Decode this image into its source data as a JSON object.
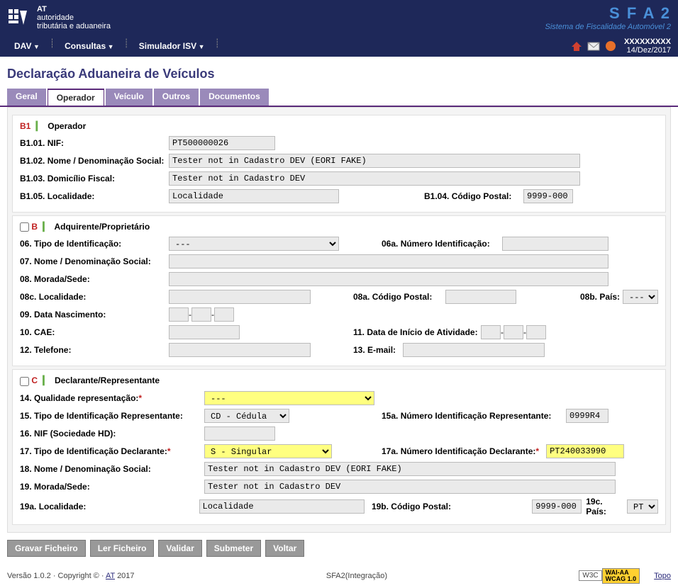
{
  "header": {
    "org1": "AT",
    "org2": "autoridade",
    "org3": "tributária e aduaneira",
    "app": "S F A 2",
    "app_sub": "Sistema de Fiscalidade Automóvel 2"
  },
  "nav": {
    "items": [
      "DAV",
      "Consultas",
      "Simulador ISV"
    ],
    "user": "XXXXXXXXX",
    "date": "14/Dez/2017"
  },
  "page_title": "Declaração Aduaneira de Veículos",
  "tabs": [
    "Geral",
    "Operador",
    "Veículo",
    "Outros",
    "Documentos"
  ],
  "active_tab": 1,
  "b1": {
    "title": "Operador",
    "l01": "B1.01. NIF:",
    "v01": "PT500000026",
    "l02": "B1.02. Nome / Denominação Social:",
    "v02": "Tester not in Cadastro DEV (EORI FAKE)",
    "l03": "B1.03. Domicílio Fiscal:",
    "v03": "Tester not in Cadastro DEV",
    "l05": "B1.05. Localidade:",
    "v05": "Localidade",
    "l04": "B1.04. Código Postal:",
    "v04": "9999-000"
  },
  "b": {
    "title": "Adquirente/Proprietário",
    "l06": "06. Tipo de Identificação:",
    "v06": "---",
    "l06a": "06a. Número Identificação:",
    "v06a": "",
    "l07": "07. Nome / Denominação Social:",
    "v07": "",
    "l08": "08. Morada/Sede:",
    "v08": "",
    "l08c": "08c. Localidade:",
    "v08c": "",
    "l08a": "08a. Código Postal:",
    "v08a": "",
    "l08b": "08b. País:",
    "v08b": "---",
    "l09": "09. Data Nascimento:",
    "l10": "10. CAE:",
    "v10": "",
    "l11": "11. Data de Início de Atividade:",
    "l12": "12. Telefone:",
    "v12": "",
    "l13": "13. E-mail:",
    "v13": ""
  },
  "c": {
    "title": "Declarante/Representante",
    "l14": "14. Qualidade representação:",
    "v14": "---",
    "l15": "15. Tipo de Identificação Representante:",
    "v15": "CD - Cédula",
    "l15a": "15a. Número Identificação Representante:",
    "v15a": "0999R4",
    "l16": "16. NIF (Sociedade HD):",
    "v16": "",
    "l17": "17. Tipo de Identificação Declarante:",
    "v17": "S - Singular",
    "l17a": "17a. Número Identificação Declarante:",
    "v17a": "PT240033990",
    "l18": "18. Nome / Denominação Social:",
    "v18": "Tester not in Cadastro DEV (EORI FAKE)",
    "l19": "19. Morada/Sede:",
    "v19": "Tester not in Cadastro DEV",
    "l19a": "19a. Localidade:",
    "v19a": "Localidade",
    "l19b": "19b. Código Postal:",
    "v19b": "9999-000",
    "l19c": "19c. País:",
    "v19c": "PT"
  },
  "buttons": {
    "gravar": "Gravar Ficheiro",
    "ler": "Ler Ficheiro",
    "validar": "Validar",
    "submeter": "Submeter",
    "voltar": "Voltar"
  },
  "footer": {
    "version": "Versão 1.0.2 · Copyright © · ",
    "at_link": "AT",
    "year": " 2017",
    "center": "SFA2(Integração)",
    "w3c": "W3C",
    "wai1": "WAI-AA",
    "wai2": "WCAG 1.0",
    "topo": "Topo"
  }
}
